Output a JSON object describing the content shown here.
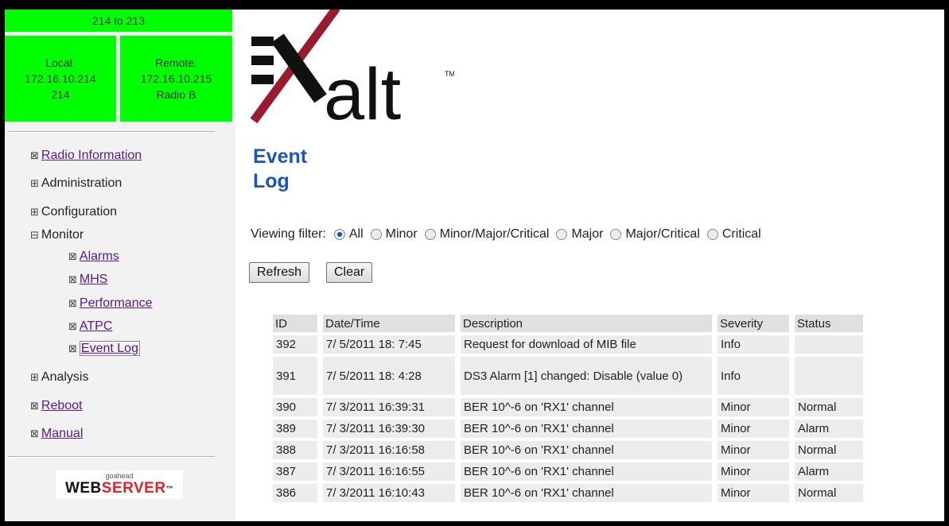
{
  "sidebar": {
    "link_name": "214 to 213",
    "local": {
      "label": "Local:",
      "ip": "172.16.10.214",
      "name": "214"
    },
    "remote": {
      "label": "Remote:",
      "ip": "172.16.10.215",
      "name": "Radio B"
    },
    "nav": {
      "radio_information": "Radio Information",
      "administration": "Administration",
      "configuration": "Configuration",
      "monitor": "Monitor",
      "alarms": "Alarms",
      "mhs": "MHS",
      "performance": "Performance",
      "atpc": "ATPC",
      "event_log": "Event Log",
      "analysis": "Analysis",
      "reboot": "Reboot",
      "manual": "Manual"
    },
    "webserver": {
      "small": "goahead",
      "word1": "WEB",
      "word2": "SERVER",
      "tm": "™"
    }
  },
  "logo": {
    "text": "alt",
    "tm": "TM"
  },
  "page_title": {
    "line1": "Event",
    "line2": "Log"
  },
  "filter": {
    "label": "Viewing filter:",
    "options": [
      "All",
      "Minor",
      "Minor/Major/Critical",
      "Major",
      "Major/Critical",
      "Critical"
    ],
    "selected": "All"
  },
  "buttons": {
    "refresh": "Refresh",
    "clear": "Clear"
  },
  "table": {
    "headers": [
      "ID",
      "Date/Time",
      "Description",
      "Severity",
      "Status"
    ],
    "rows": [
      {
        "id": "392",
        "datetime": "7/ 5/2011 18: 7:45",
        "description": "Request for download of MIB file",
        "severity": "Info",
        "status": ""
      },
      {
        "id": "391",
        "datetime": "7/ 5/2011 18: 4:28",
        "description": "DS3 Alarm [1] changed: Disable (value 0)",
        "severity": "Info",
        "status": ""
      },
      {
        "id": "390",
        "datetime": "7/ 3/2011 16:39:31",
        "description": "BER 10^-6 on 'RX1' channel",
        "severity": "Minor",
        "status": "Normal"
      },
      {
        "id": "389",
        "datetime": "7/ 3/2011 16:39:30",
        "description": "BER 10^-6 on 'RX1' channel",
        "severity": "Minor",
        "status": "Alarm"
      },
      {
        "id": "388",
        "datetime": "7/ 3/2011 16:16:58",
        "description": "BER 10^-6 on 'RX1' channel",
        "severity": "Minor",
        "status": "Normal"
      },
      {
        "id": "387",
        "datetime": "7/ 3/2011 16:16:55",
        "description": "BER 10^-6 on 'RX1' channel",
        "severity": "Minor",
        "status": "Alarm"
      },
      {
        "id": "386",
        "datetime": "7/ 3/2011 16:10:43",
        "description": "BER 10^-6 on 'RX1' channel",
        "severity": "Minor",
        "status": "Normal"
      }
    ]
  },
  "colors": {
    "status_green": "#00ff00",
    "title_blue": "#1a56b8",
    "logo_red": "#9b1b2e",
    "link_purple": "#551a8b"
  }
}
